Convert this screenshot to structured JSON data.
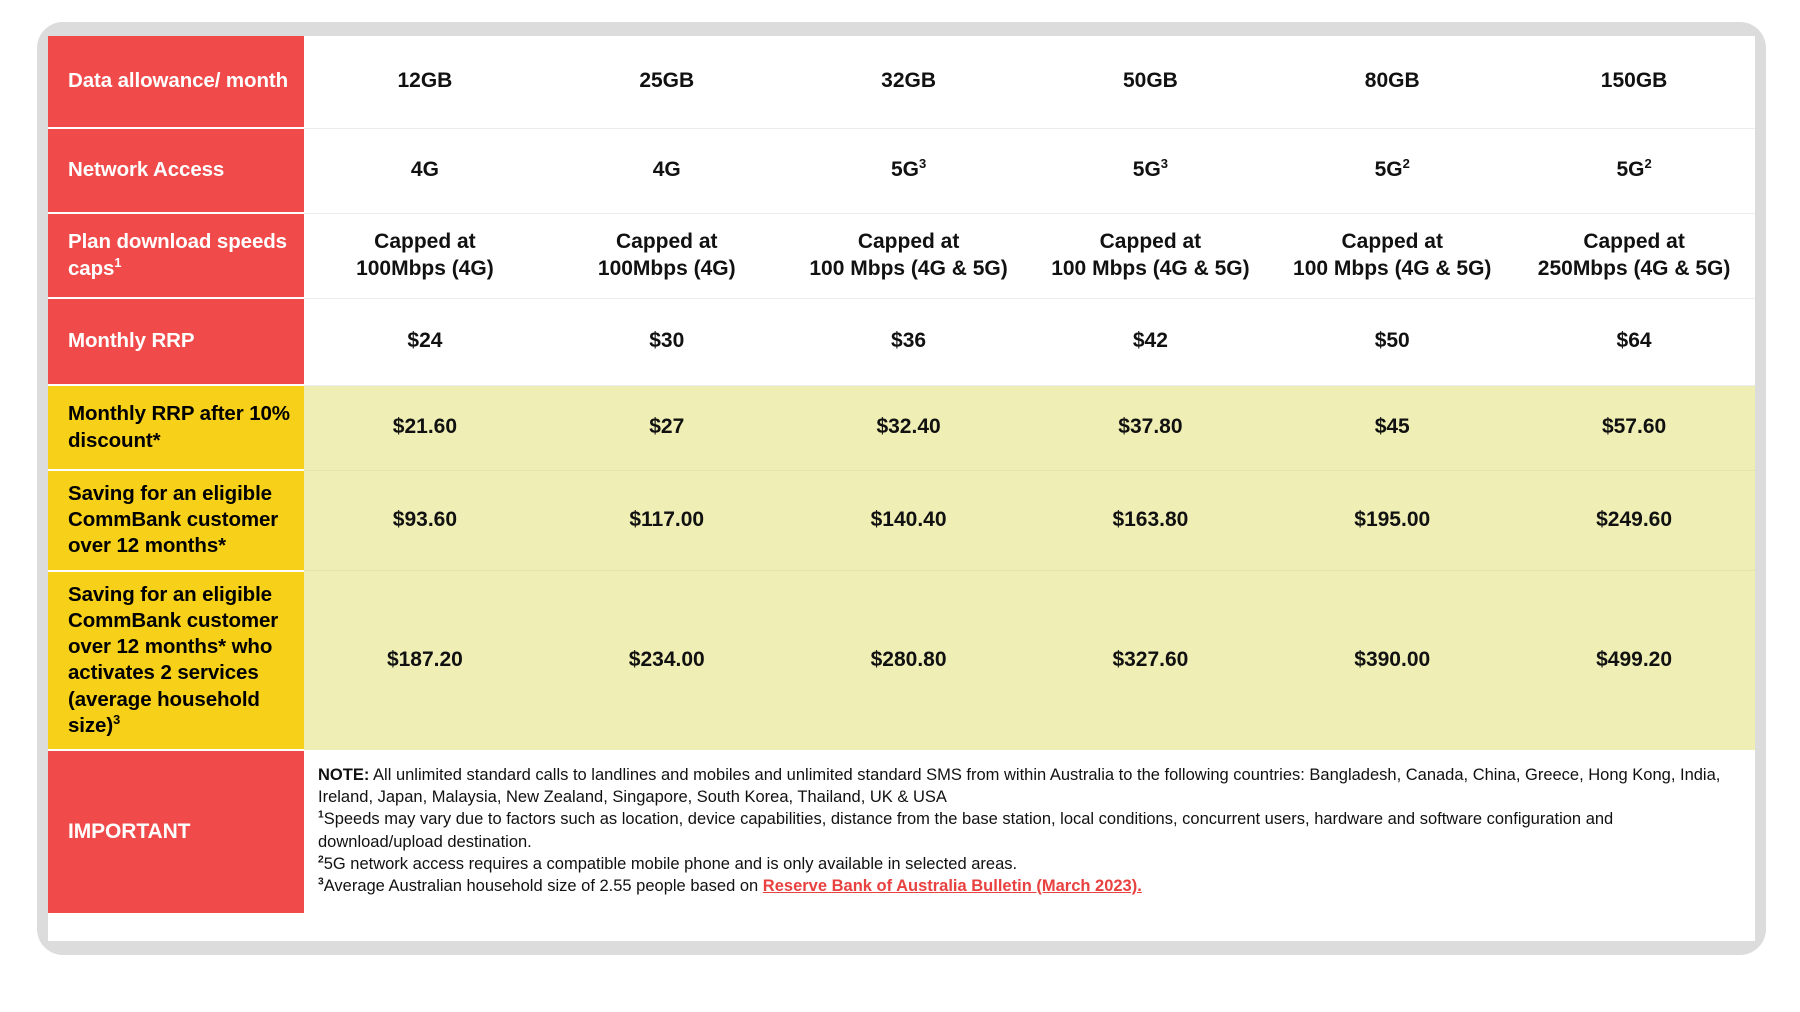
{
  "theme": {
    "red": "#f04a4a",
    "yellow_label": "#f6d019",
    "yellow_cell": "#efeeb4",
    "frame_grey": "#dcdcdc",
    "link_red": "#e8413f",
    "text_dark": "#111111",
    "text_light": "#ffffff"
  },
  "table": {
    "rows": [
      {
        "id": "data-allowance",
        "label": "Data allowance/ month",
        "label_style": "red",
        "cells": [
          "12GB",
          "25GB",
          "32GB",
          "50GB",
          "80GB",
          "150GB"
        ]
      },
      {
        "id": "network-access",
        "label": "Network Access",
        "label_style": "red",
        "cells": [
          "4G",
          "4G",
          "5G3",
          "5G3",
          "5G2",
          "5G2"
        ],
        "cells_super": [
          {
            "base": "4G",
            "sup": ""
          },
          {
            "base": "4G",
            "sup": ""
          },
          {
            "base": "5G",
            "sup": "3"
          },
          {
            "base": "5G",
            "sup": "3"
          },
          {
            "base": "5G",
            "sup": "2"
          },
          {
            "base": "5G",
            "sup": "2"
          }
        ]
      },
      {
        "id": "plan-download-speeds",
        "label": "Plan download speeds caps1",
        "label_style": "red",
        "cells": [
          "Capped at 100Mbps (4G)",
          "Capped at 100Mbps (4G)",
          "Capped at 100 Mbps (4G & 5G)",
          "Capped at 100 Mbps (4G & 5G)",
          "Capped at 100 Mbps (4G & 5G)",
          "Capped at 250Mbps (4G & 5G)"
        ],
        "cells_lines": [
          [
            "Capped at",
            "100Mbps (4G)"
          ],
          [
            "Capped at",
            "100Mbps (4G)"
          ],
          [
            "Capped at",
            "100 Mbps (4G & 5G)"
          ],
          [
            "Capped at",
            "100 Mbps (4G & 5G)"
          ],
          [
            "Capped at",
            "100 Mbps (4G & 5G)"
          ],
          [
            "Capped at",
            "250Mbps (4G & 5G)"
          ]
        ]
      },
      {
        "id": "monthly-rrp",
        "label": "Monthly RRP",
        "label_style": "red",
        "cells": [
          "$24",
          "$30",
          "$36",
          "$42",
          "$50",
          "$64"
        ]
      },
      {
        "id": "monthly-rrp-after-discount",
        "label": "Monthly RRP after 10% discount*",
        "label_style": "yellow",
        "cells": [
          "$21.60",
          "$27",
          "$32.40",
          "$37.80",
          "$45",
          "$57.60"
        ]
      },
      {
        "id": "saving-12-months",
        "label": "Saving for an eligible CommBank customer over 12 months*",
        "label_style": "yellow",
        "cells": [
          "$93.60",
          "$117.00",
          "$140.40",
          "$163.80",
          "$195.00",
          "$249.60"
        ]
      },
      {
        "id": "saving-12-months-two-services",
        "label": "Saving for an eligible CommBank customer over 12 months* who activates 2 services (average household size)3",
        "label_style": "yellow",
        "cells": [
          "$187.20",
          "$234.00",
          "$280.80",
          "$327.60",
          "$390.00",
          "$499.20"
        ]
      }
    ]
  },
  "important": {
    "label": "IMPORTANT",
    "note_prefix": "NOTE:",
    "note_body": " All unlimited standard calls to landlines and mobiles and unlimited standard SMS from within Australia to the following countries: Bangladesh, Canada, China, Greece, Hong Kong, India, Ireland, Japan, Malaysia, New Zealand, Singapore, South Korea, Thailand, UK & USA",
    "footnote_1_marker": "1",
    "footnote_1": "Speeds may vary due to factors such as location, device capabilities, distance from the base station, local conditions, concurrent users, hardware and software configuration and download/upload destination.",
    "footnote_2_marker": "2",
    "footnote_2": "5G network access requires a compatible mobile phone and is only available in selected areas.",
    "footnote_3_marker": "3",
    "footnote_3_pre": "Average Australian household size of 2.55 people based on ",
    "footnote_3_link": "Reserve Bank of Australia Bulletin (March 2023)."
  }
}
